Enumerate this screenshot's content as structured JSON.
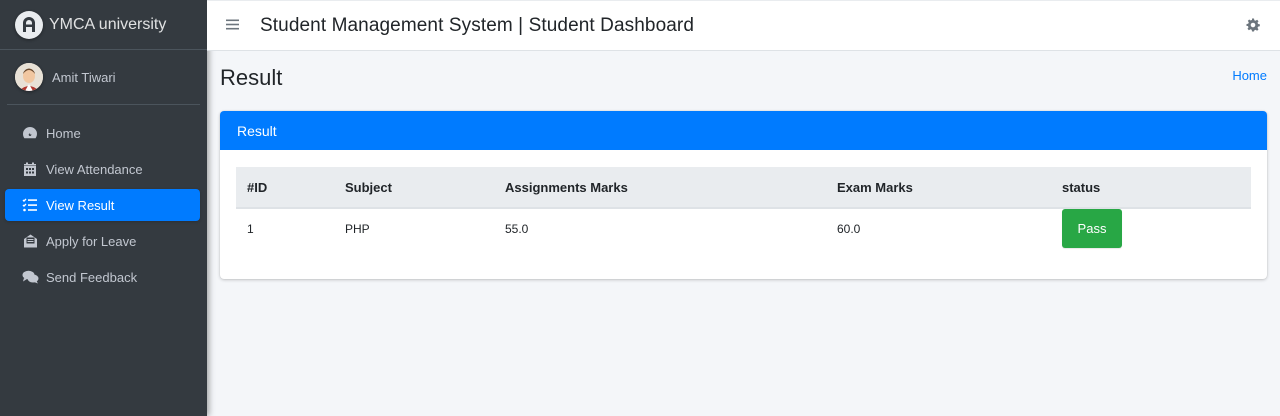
{
  "brand": {
    "name": "YMCA university"
  },
  "user": {
    "name": "Amit Tiwari"
  },
  "sidebar": {
    "items": [
      {
        "label": "Home",
        "icon": "dashboard-icon",
        "active": false
      },
      {
        "label": "View Attendance",
        "icon": "calendar-icon",
        "active": false
      },
      {
        "label": "View Result",
        "icon": "list-icon",
        "active": true
      },
      {
        "label": "Apply for Leave",
        "icon": "envelope-open-icon",
        "active": false
      },
      {
        "label": "Send Feedback",
        "icon": "comments-icon",
        "active": false
      }
    ]
  },
  "topbar": {
    "title": "Student Management System | Student Dashboard"
  },
  "page": {
    "title": "Result",
    "breadcrumb_home": "Home"
  },
  "card": {
    "title": "Result",
    "table": {
      "headers": [
        "#ID",
        "Subject",
        "Assignments Marks",
        "Exam Marks",
        "status"
      ],
      "rows": [
        {
          "id": "1",
          "subject": "PHP",
          "assignments": "55.0",
          "exam": "60.0",
          "status": "Pass"
        }
      ]
    }
  },
  "colors": {
    "sidebar_bg": "#343a40",
    "accent": "#007bff",
    "success": "#28a745"
  }
}
